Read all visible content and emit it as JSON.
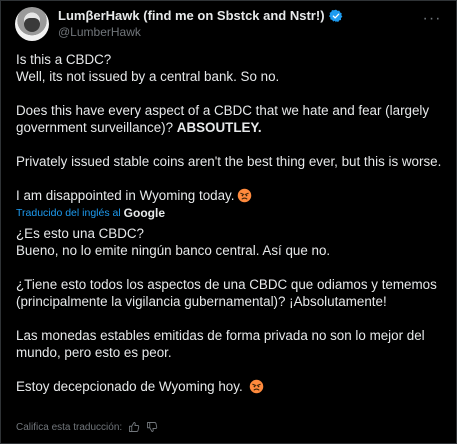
{
  "author": {
    "display_name": "LumβerHawk (find me on Sbstck and Nstr!)",
    "handle": "@LumberHawk",
    "verified_icon": "verified-badge-icon",
    "accent": "#1d9bf0"
  },
  "menu": {
    "more_label": "···"
  },
  "tweet": {
    "p1_line1": "Is this a CBDC?",
    "p1_line2": "Well, its not issued by a central bank. So no.",
    "p2_text": "Does this have every aspect of a CBDC that we hate and fear (largely government surveillance)? ",
    "p2_bold": "ABSOUTLEY.",
    "p3": "Privately issued stable coins aren't the best thing ever, but this is worse.",
    "p4": "I am disappointed in Wyoming today.",
    "p4_emoji": "angry-face-emoji"
  },
  "translation": {
    "source_label": "Traducido del inglés al",
    "provider": "Google",
    "p1_line1": "¿Es esto una CBDC?",
    "p1_line2": "Bueno, no lo emite ningún banco central. Así que no.",
    "p2": "¿Tiene esto todos los aspectos de una CBDC que odiamos y tememos (principalmente la vigilancia gubernamental)? ¡Absolutamente!",
    "p3": "Las monedas estables emitidas de forma privada no son lo mejor del mundo, pero esto es peor.",
    "p4": "Estoy decepcionado de Wyoming hoy. ",
    "p4_emoji": "angry-face-emoji",
    "rate_label": "Califica esta traducción:",
    "rate_icons": [
      "thumbs-up-icon",
      "thumbs-down-icon"
    ]
  }
}
